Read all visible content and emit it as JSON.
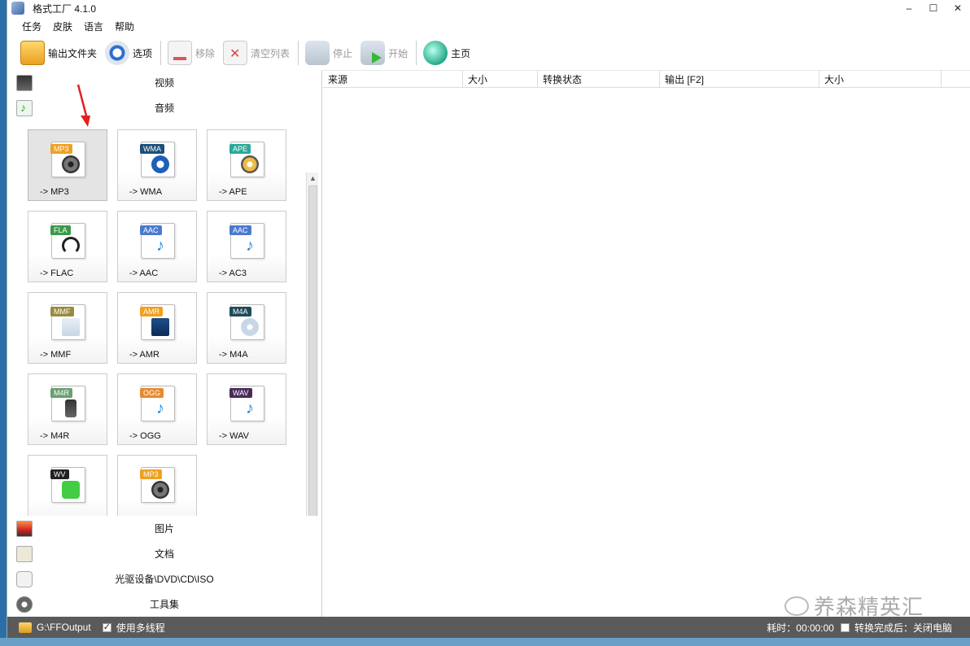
{
  "window": {
    "title": "格式工厂 4.1.0",
    "minimize": "–",
    "maximize": "☐",
    "close": "✕"
  },
  "menu": [
    "任务",
    "皮肤",
    "语言",
    "帮助"
  ],
  "toolbar": {
    "output_folder": "输出文件夹",
    "options": "选项",
    "remove": "移除",
    "clear_list": "清空列表",
    "stop": "停止",
    "start": "开始",
    "home": "主页"
  },
  "categories": {
    "video": "视频",
    "audio": "音频",
    "picture": "图片",
    "document": "文档",
    "disc": "光驱设备\\DVD\\CD\\ISO",
    "tools": "工具集"
  },
  "formats": [
    {
      "badge": "MP3",
      "label": "-> MP3",
      "color": "#f0a020"
    },
    {
      "badge": "WMA",
      "label": "-> WMA",
      "color": "#1d4f7a"
    },
    {
      "badge": "APE",
      "label": "-> APE",
      "color": "#2aa89a"
    },
    {
      "badge": "FLA",
      "label": "-> FLAC",
      "color": "#3a9a4a"
    },
    {
      "badge": "AAC",
      "label": "-> AAC",
      "color": "#4a7ad0"
    },
    {
      "badge": "AAC",
      "label": "-> AC3",
      "color": "#4a7ad0"
    },
    {
      "badge": "MMF",
      "label": "-> MMF",
      "color": "#9a8a40"
    },
    {
      "badge": "AMR",
      "label": "-> AMR",
      "color": "#f0a020"
    },
    {
      "badge": "M4A",
      "label": "-> M4A",
      "color": "#1d4a5a"
    },
    {
      "badge": "M4R",
      "label": "-> M4R",
      "color": "#6aa070"
    },
    {
      "badge": "OGG",
      "label": "-> OGG",
      "color": "#e88a30"
    },
    {
      "badge": "WAV",
      "label": "-> WAV",
      "color": "#4a2a5a"
    },
    {
      "badge": "WV",
      "label": "",
      "color": "#222222"
    },
    {
      "badge": "MP3",
      "label": "",
      "color": "#f0a020"
    }
  ],
  "columns": [
    "来源",
    "大小",
    "转换状态",
    "输出 [F2]",
    "大小"
  ],
  "status": {
    "output_path": "G:\\FFOutput",
    "multithread": "使用多线程",
    "elapsed": "耗时：00:00:00",
    "after_convert": "转换完成后：关闭电脑"
  },
  "watermark": "养森精英汇"
}
